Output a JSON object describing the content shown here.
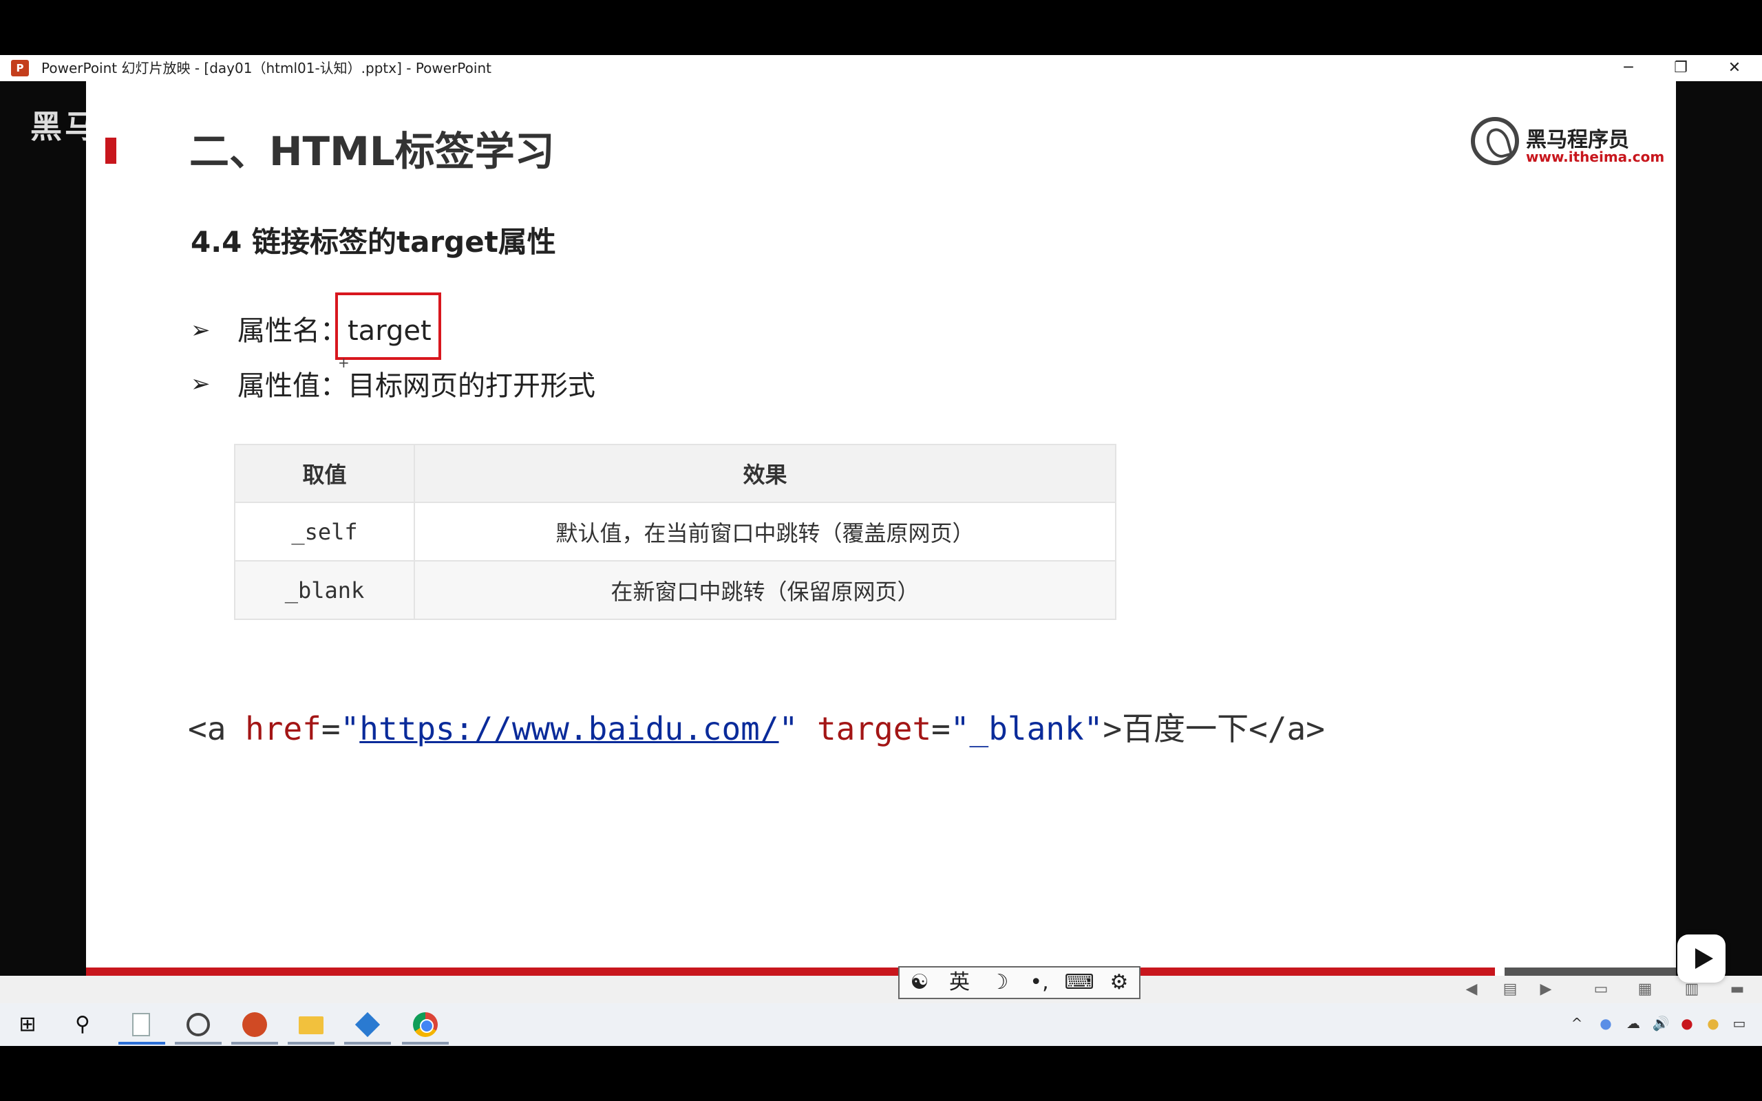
{
  "window": {
    "app_icon_letter": "P",
    "title": "PowerPoint 幻灯片放映 - [day01（html01-认知）.pptx] - PowerPoint",
    "minimize": "─",
    "restore": "❐",
    "close": "✕"
  },
  "slide": {
    "corner_mark": "黑马",
    "title": "二、HTML标签学习",
    "logo": {
      "name": "黑马程序员",
      "url": "www.itheima.com"
    },
    "subtitle": "4.4 链接标签的target属性",
    "bullets": [
      {
        "marker": "➢",
        "label": "属性名：",
        "value": "target"
      },
      {
        "marker": "➢",
        "label": "属性值：",
        "value": "目标网页的打开形式"
      }
    ],
    "table": {
      "headers": [
        "取值",
        "效果"
      ],
      "rows": [
        [
          "_self",
          "默认值，在当前窗口中跳转（覆盖原网页）"
        ],
        [
          "_blank",
          "在新窗口中跳转（保留原网页）"
        ]
      ]
    },
    "code": {
      "open_tag": "<a ",
      "href_attr": "href",
      "eq1": "=",
      "quote_open1": "\"",
      "href_value": "https://www.baidu.com/",
      "quote_close1": "\"",
      "target_attr": "target",
      "eq2": "=",
      "target_value": "\"_blank\"",
      "gt": ">",
      "link_text": "百度一下",
      "close_tag": "</a>"
    }
  },
  "ime_toolbar": {
    "items": [
      "☯",
      "英",
      "☽",
      "•,",
      "⌨",
      "⚙"
    ]
  },
  "slideshow_nav": {
    "prev": "◀",
    "menu": "▤",
    "next": "▶",
    "views": [
      "▭",
      "▦",
      "▥",
      "▬"
    ]
  },
  "taskbar": {
    "start": "⊞",
    "search": "⚲",
    "apps": [
      "notepad",
      "clock",
      "powerpoint",
      "explorer",
      "vscode",
      "chrome"
    ],
    "tray": [
      "^",
      "●",
      "☁",
      "🔊",
      "●",
      "●",
      "▭"
    ]
  }
}
